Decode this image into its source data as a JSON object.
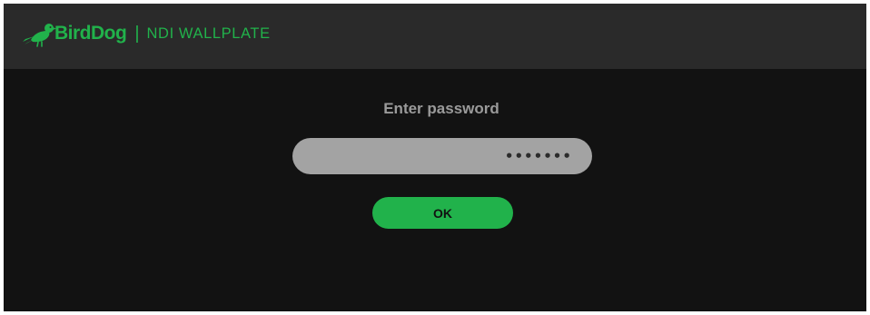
{
  "header": {
    "brand": "BirdDog",
    "separator": "|",
    "product": "NDI WALLPLATE",
    "logo_icon": "bird-logo-icon",
    "background": "#2a2a2a",
    "accent": "#21b24b"
  },
  "login": {
    "prompt": "Enter password",
    "password_value": "•••••••",
    "password_placeholder": "",
    "ok_label": "OK",
    "background": "#121212",
    "field_color": "#a3a3a3",
    "button_color": "#21b24b"
  }
}
